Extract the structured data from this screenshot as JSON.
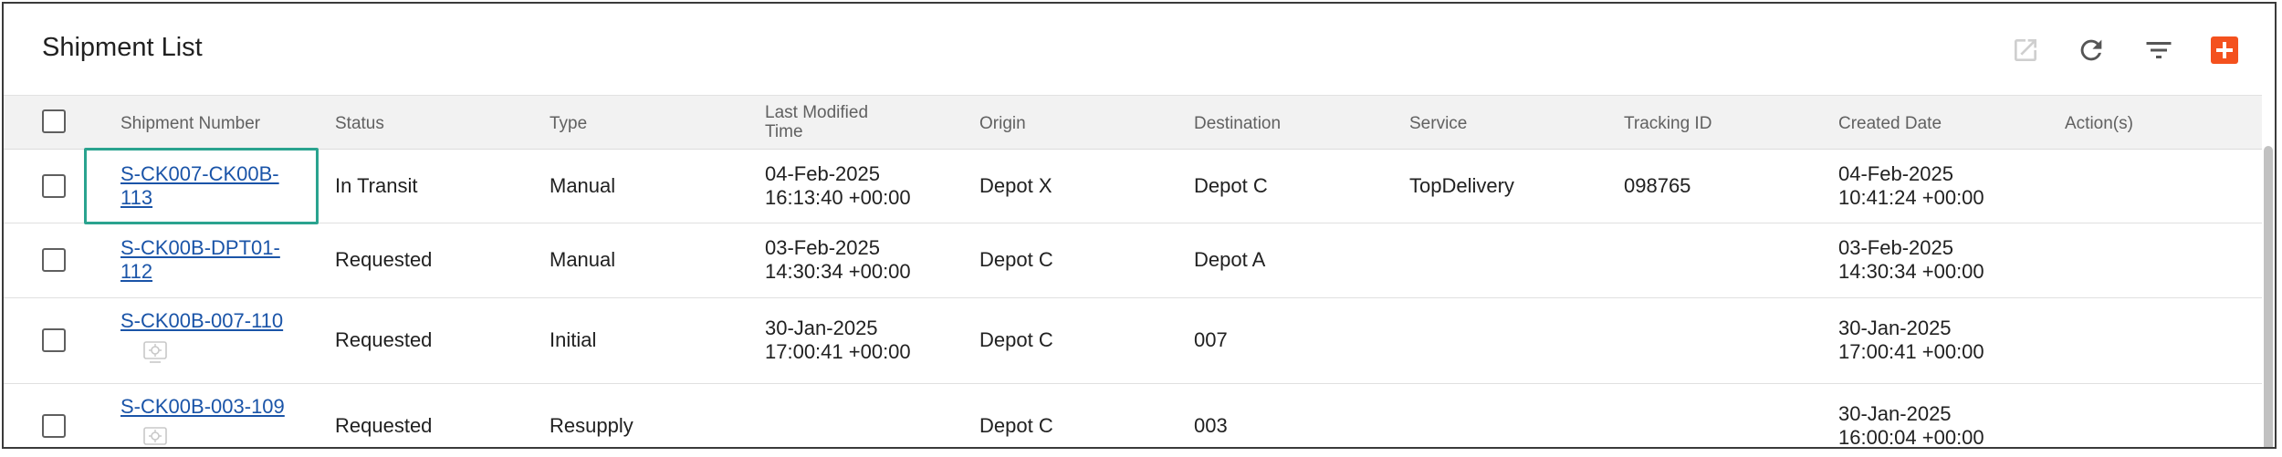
{
  "header": {
    "title": "Shipment List",
    "toolbar": {
      "export_icon": "open-in-new-icon",
      "refresh_icon": "refresh-icon",
      "filter_icon": "filter-list-icon",
      "add_icon": "plus-icon"
    }
  },
  "colors": {
    "accent": "#f4511e",
    "link": "#1a54a8",
    "highlight": "#2aa38f",
    "header_bg": "#f2f2f2"
  },
  "table": {
    "columns": {
      "shipment_number": "Shipment Number",
      "status": "Status",
      "type": "Type",
      "last_modified_line1": "Last Modified",
      "last_modified_line2": "Time",
      "origin": "Origin",
      "destination": "Destination",
      "service": "Service",
      "tracking_id": "Tracking ID",
      "created_date": "Created Date",
      "actions": "Action(s)"
    },
    "rows": [
      {
        "shipment_line1": "S-CK007-CK00B-",
        "shipment_line2": "113",
        "status": "In Transit",
        "type": "Manual",
        "modified_date": "04-Feb-2025",
        "modified_time": "16:13:40 +00:00",
        "origin": "Depot X",
        "destination": "Depot C",
        "service": "TopDelivery",
        "tracking_id": "098765",
        "created_date": "04-Feb-2025",
        "created_time": "10:41:24 +00:00"
      },
      {
        "shipment_line1": "S-CK00B-DPT01-",
        "shipment_line2": "112",
        "status": "Requested",
        "type": "Manual",
        "modified_date": "03-Feb-2025",
        "modified_time": "14:30:34 +00:00",
        "origin": "Depot C",
        "destination": "Depot A",
        "service": "",
        "tracking_id": "",
        "created_date": "03-Feb-2025",
        "created_time": "14:30:34 +00:00"
      },
      {
        "shipment_line1": "S-CK00B-007-110",
        "status": "Requested",
        "type": "Initial",
        "modified_date": "30-Jan-2025",
        "modified_time": "17:00:41 +00:00",
        "origin": "Depot C",
        "destination": "007",
        "service": "",
        "tracking_id": "",
        "created_date": "30-Jan-2025",
        "created_time": "17:00:41 +00:00",
        "icon": "auto-generated-icon"
      },
      {
        "shipment_line1": "S-CK00B-003-109",
        "status": "Requested",
        "type": "Resupply",
        "modified_date": "",
        "modified_time": "",
        "origin": "Depot C",
        "destination": "003",
        "service": "",
        "tracking_id": "",
        "created_date": "30-Jan-2025",
        "created_time": "16:00:04 +00:00",
        "icon": "auto-generated-icon"
      }
    ]
  }
}
